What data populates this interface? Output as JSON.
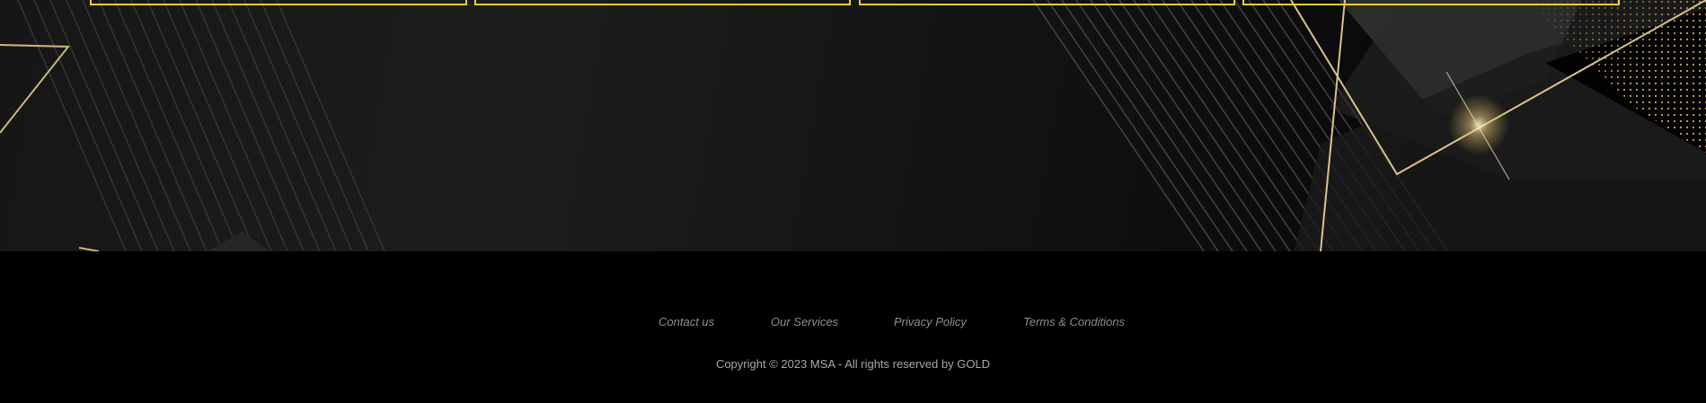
{
  "footer": {
    "links": [
      {
        "label": "Contact us"
      },
      {
        "label": "Our Services"
      },
      {
        "label": "Privacy Policy"
      },
      {
        "label": "Terms & Conditions"
      }
    ],
    "copyright_prefix": "Copyright © 2023 MSA - All rights reserved by ",
    "copyright_brand": "GOLD"
  },
  "colors": {
    "card_border": "#f2cf2a",
    "gold_line": "#d9c38a",
    "footer_bg": "#000000",
    "link_text": "#8f8f8f"
  },
  "decor": {
    "icons": [
      "gold-triangle-outline",
      "diagonal-pinstripes",
      "gold-dot-grid",
      "light-flare"
    ]
  }
}
